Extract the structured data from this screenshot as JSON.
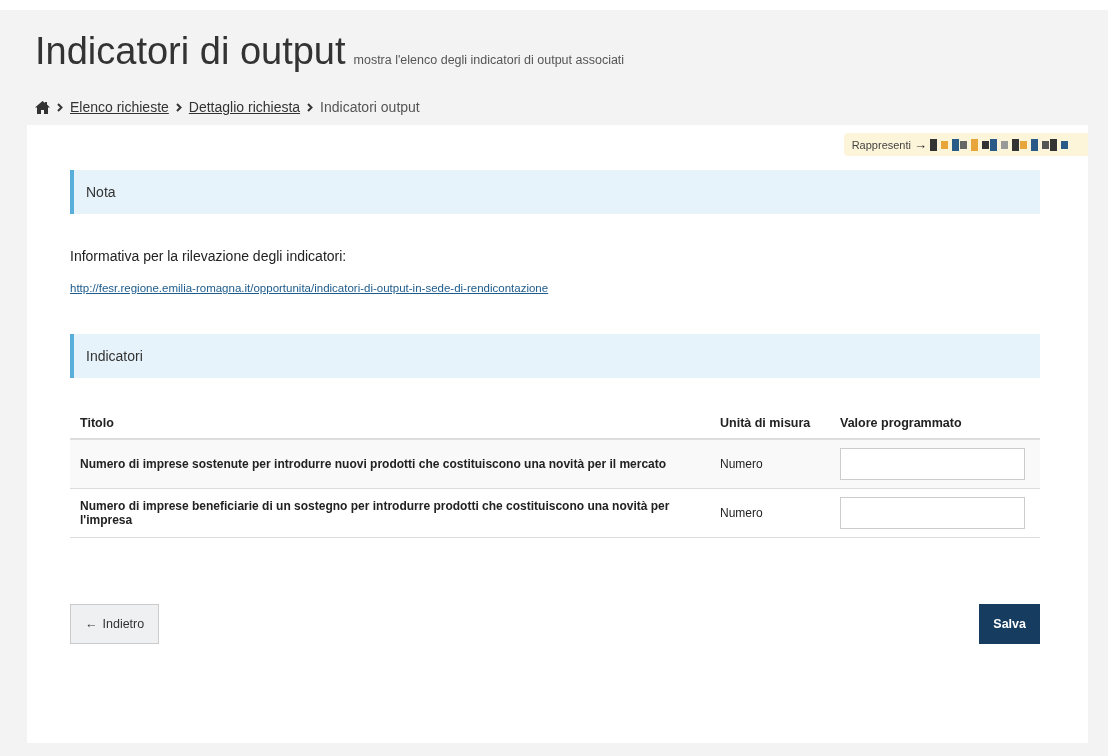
{
  "header": {
    "title": "Indicatori di output",
    "subtitle": "mostra l'elenco degli indicatori di output associati"
  },
  "breadcrumb": [
    {
      "label": "Elenco richieste",
      "kind": "link"
    },
    {
      "label": "Dettaglio richiesta",
      "kind": "link"
    },
    {
      "label": "Indicatori output",
      "kind": "current"
    }
  ],
  "represent": {
    "label": "Rappresenti",
    "arrow": "→"
  },
  "note_panel": {
    "title": "Nota"
  },
  "info": {
    "text": "Informativa per la rilevazione degli indicatori:",
    "link": "http://fesr.regione.emilia-romagna.it/opportunita/indicatori-di-output-in-sede-di-rendicontazione"
  },
  "indicators_panel": {
    "title": "Indicatori"
  },
  "table": {
    "columns": [
      "Titolo",
      "Unità di misura",
      "Valore programmato"
    ],
    "rows": [
      {
        "title": "Numero di imprese sostenute per introdurre nuovi prodotti che costituiscono una novità per il mercato",
        "unit": "Numero"
      },
      {
        "title": "Numero di imprese beneficiarie di un sostegno per introdurre prodotti che costituiscono una novità per l'impresa",
        "unit": "Numero"
      }
    ]
  },
  "buttons": {
    "back": {
      "icon": "←",
      "label": "Indietro"
    },
    "save": {
      "label": "Salva"
    }
  }
}
